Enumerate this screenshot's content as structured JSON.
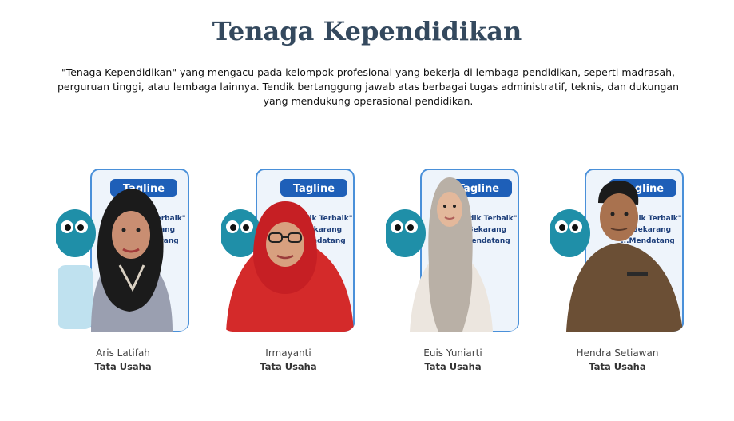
{
  "section": {
    "title": "Tenaga Kependidikan",
    "description": "\"Tenaga Kependidikan\" yang mengacu pada kelompok profesional yang bekerja di lembaga pendidikan, seperti madrasah, perguruan tinggi, atau lembaga lainnya. Tendik bertanggung jawab atas berbagai tugas administratif, teknis, dan dukungan yang mendukung operasional pendidikan."
  },
  "staff": [
    {
      "name": "Aris Latifah",
      "role": "Tata Usaha",
      "photo": "woman-black-hijab-photo"
    },
    {
      "name": "Irmayanti",
      "role": "Tata Usaha",
      "photo": "woman-red-hijab-photo"
    },
    {
      "name": "Euis Yuniarti",
      "role": "Tata Usaha",
      "photo": "woman-grey-hijab-photo"
    },
    {
      "name": "Hendra Setiawan",
      "role": "Tata Usaha",
      "photo": "man-khaki-uniform-photo"
    }
  ],
  "backdrop": {
    "banner_text": "Tagline",
    "line1": "\"...didik Terbaik\"",
    "line2": "...Sekarang",
    "line3": "...Mendatang"
  },
  "colors": {
    "title": "#34495e",
    "banner_blue": "#1e5fb8",
    "mascot_teal": "#1f8fa8",
    "hijab_red": "#d42a2a",
    "hijab_black": "#1b1b1b",
    "hijab_grey": "#b9b0a6",
    "uniform_khaki": "#6b4f35"
  }
}
